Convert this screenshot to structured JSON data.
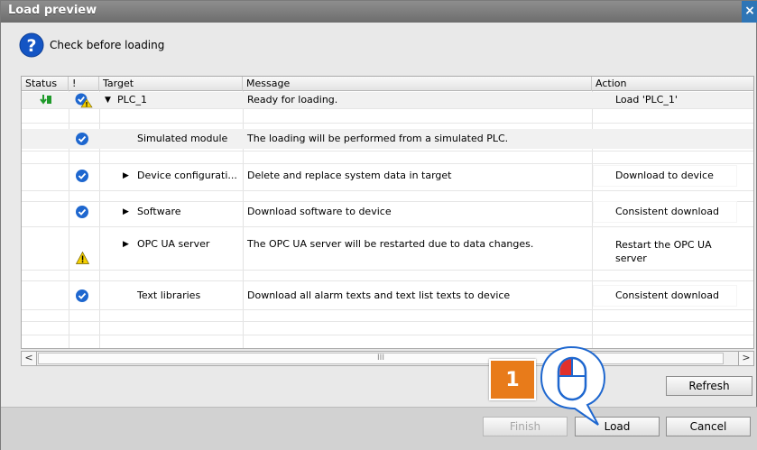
{
  "window": {
    "title": "Load preview",
    "close_glyph": "×"
  },
  "header": {
    "text": "Check before loading",
    "icon": "question-icon"
  },
  "columns": [
    "Status",
    "!",
    "Target",
    "Message",
    "Action"
  ],
  "rows": [
    {
      "status": "load-arrow-icon",
      "flag": "ok-warning-icon",
      "expander": "▼",
      "target": "PLC_1",
      "message": "Ready for loading.",
      "action": "Load 'PLC_1'"
    },
    {
      "flag": "ok-icon",
      "expander": "",
      "target": "Simulated module",
      "message": "The loading will be performed from a simulated PLC.",
      "action": ""
    },
    {
      "flag": "ok-icon",
      "expander": "▶",
      "target": "Device configurati...",
      "message": "Delete and replace system data in target",
      "action": "Download to device"
    },
    {
      "flag": "ok-icon",
      "expander": "▶",
      "target": "Software",
      "message": "Download software to device",
      "action": "Consistent download"
    },
    {
      "flag": "warning-icon",
      "expander": "▶",
      "target": "OPC UA server",
      "message": "The OPC UA server will be restarted due to data changes.",
      "action_line1": "Restart the OPC UA",
      "action_line2": "server"
    },
    {
      "flag": "ok-icon",
      "expander": "",
      "target": "Text libraries",
      "message": "Download all alarm texts and text list texts to device",
      "action": "Consistent download"
    }
  ],
  "scrollbar": {
    "left": "<",
    "right": ">",
    "thumb": "III"
  },
  "buttons": {
    "refresh": "Refresh",
    "finish": "Finish",
    "load": "Load",
    "cancel": "Cancel"
  },
  "callout": {
    "number": "1",
    "icon": "mouse-left-click-icon"
  },
  "colors": {
    "accent": "#1e67cf",
    "warning": "#f5d000",
    "callout": "#e87b1a",
    "titlebar": "#7d7d7d"
  }
}
